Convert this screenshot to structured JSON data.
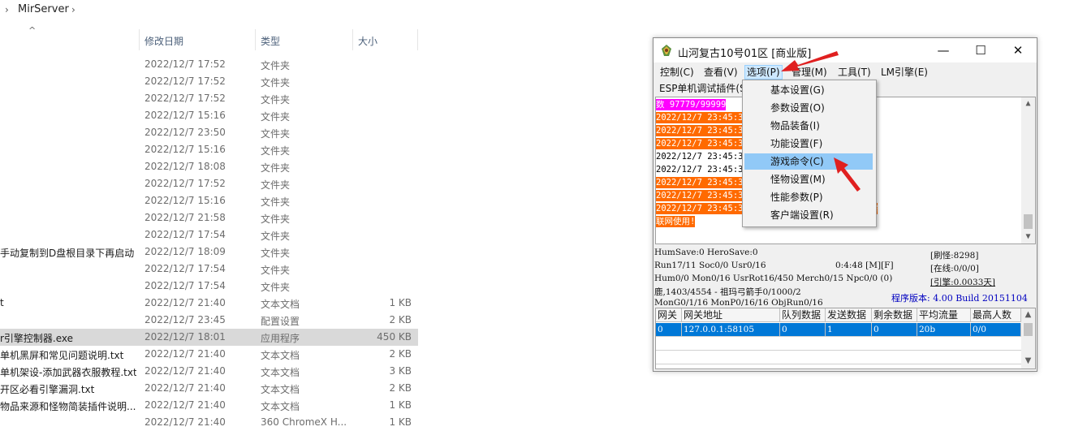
{
  "explorer": {
    "breadcrumb": {
      "chevron_left": "›",
      "folder": "MirServer",
      "chevron_right": "›"
    },
    "sort_indicator": "^",
    "columns": {
      "date": "修改日期",
      "type": "类型",
      "size": "大小"
    },
    "rows": [
      {
        "name": "",
        "date": "2022/12/7 17:52",
        "type": "文件夹",
        "size": ""
      },
      {
        "name": "",
        "date": "2022/12/7 17:52",
        "type": "文件夹",
        "size": ""
      },
      {
        "name": "",
        "date": "2022/12/7 17:52",
        "type": "文件夹",
        "size": ""
      },
      {
        "name": "",
        "date": "2022/12/7 15:16",
        "type": "文件夹",
        "size": ""
      },
      {
        "name": "",
        "date": "2022/12/7 23:50",
        "type": "文件夹",
        "size": ""
      },
      {
        "name": "",
        "date": "2022/12/7 15:16",
        "type": "文件夹",
        "size": ""
      },
      {
        "name": "",
        "date": "2022/12/7 18:08",
        "type": "文件夹",
        "size": ""
      },
      {
        "name": "",
        "date": "2022/12/7 17:52",
        "type": "文件夹",
        "size": ""
      },
      {
        "name": "",
        "date": "2022/12/7 15:16",
        "type": "文件夹",
        "size": ""
      },
      {
        "name": "",
        "date": "2022/12/7 21:58",
        "type": "文件夹",
        "size": ""
      },
      {
        "name": "",
        "date": "2022/12/7 17:54",
        "type": "文件夹",
        "size": ""
      },
      {
        "name": "手动复制到D盘根目录下再启动",
        "date": "2022/12/7 18:09",
        "type": "文件夹",
        "size": ""
      },
      {
        "name": "",
        "date": "2022/12/7 17:54",
        "type": "文件夹",
        "size": ""
      },
      {
        "name": "",
        "date": "2022/12/7 17:54",
        "type": "文件夹",
        "size": ""
      },
      {
        "name": "t",
        "date": "2022/12/7 21:40",
        "type": "文本文档",
        "size": "1 KB"
      },
      {
        "name": "",
        "date": "2022/12/7 23:45",
        "type": "配置设置",
        "size": "2 KB"
      },
      {
        "name": "r引擎控制器.exe",
        "date": "2022/12/7 18:01",
        "type": "应用程序",
        "size": "450 KB",
        "selected": true
      },
      {
        "name": "单机黑屏和常见问题说明.txt",
        "date": "2022/12/7 21:40",
        "type": "文本文档",
        "size": "2 KB"
      },
      {
        "name": "单机架设-添加武器衣服教程.txt",
        "date": "2022/12/7 21:40",
        "type": "文本文档",
        "size": "3 KB"
      },
      {
        "name": "开区必看引擎漏洞.txt",
        "date": "2022/12/7 21:40",
        "type": "文本文档",
        "size": "2 KB"
      },
      {
        "name": "物品来源和怪物简装插件说明....",
        "date": "2022/12/7 21:40",
        "type": "文本文档",
        "size": "1 KB"
      },
      {
        "name": "",
        "date": "2022/12/7 21:40",
        "type": "360 ChromeX H...",
        "size": "1 KB"
      }
    ]
  },
  "app": {
    "title": "山河复古10号01区 [商业版]",
    "controls": {
      "minimize": "—",
      "maximize": "☐",
      "close": "✕"
    },
    "menu": [
      "控制(C)",
      "查看(V)",
      "选项(P)",
      "管理(M)",
      "工具(T)",
      "LM引擎(E)"
    ],
    "menu_row2": "ESP单机调试插件(S",
    "log": [
      {
        "text": "数 97779/99999",
        "style": "magenta"
      },
      {
        "text": "2022/12/7 23:45:30",
        "style": "orange"
      },
      {
        "text": "2022/12/7 23:45:30                              部间修复成功...",
        "style": "orange"
      },
      {
        "text": "2022/12/7 23:45:30",
        "style": "orange"
      },
      {
        "text": "2022/12/7 23:45:31                              0)连接成功...",
        "style": "plain"
      },
      {
        "text": "2022/12/7 23:45:32                              5)已打开...",
        "style": "plain"
      },
      {
        "text": "2022/12/7 23:45:33                              门修复成功...",
        "style": "orange"
      },
      {
        "text": "2022/12/7 23:45:33                              0)",
        "style": "orange"
      },
      {
        "text": "2022/12/7 23:45:33                              行止用途，上限5人，不反挂，需",
        "style": "orange"
      },
      {
        "text": "联网使用!",
        "style": "orange"
      }
    ],
    "status": {
      "l1": "HumSave:0 HeroSave:0",
      "l2": "Run17/11 Soc0/0 Usr0/16",
      "l2b": "0:4:48 [M][F]",
      "l3": "Hum0/0 Mon0/16 UsrRot16/450 Merch0/15 Npc0/0 (0)",
      "l4": "鹿,1403/4554 - 祖玛弓箭手0/1000/2",
      "l5": "MonG0/1/16 MonP0/16/16 ObjRun0/16",
      "r1": "[刷怪:8298]",
      "r2": "[在线:0/0/0]",
      "r3": "[引擎:0.0033天]",
      "version": "程序版本: 4.00 Build 20151104"
    },
    "grid": {
      "headers": [
        "网关",
        "网关地址",
        "队列数据",
        "发送数据",
        "剩余数据",
        "平均流量",
        "最高人数"
      ],
      "rows": [
        [
          "0",
          "127.0.0.1:58105",
          "0",
          "1",
          "0",
          "20b",
          "0/0"
        ]
      ]
    }
  },
  "dropdown": {
    "items": [
      "基本设置(G)",
      "参数设置(O)",
      "物品装备(I)",
      "功能设置(F)",
      "游戏命令(C)",
      "怪物设置(M)",
      "性能参数(P)",
      "客户端设置(R)"
    ],
    "highlighted": "游戏命令(C)"
  },
  "colors": {
    "log_orange": "#ff6a00",
    "log_magenta": "#ff00ff",
    "selection_blue": "#0078d7",
    "menu_hover": "#91c9f7",
    "arrow_red": "#e02020"
  },
  "icons": [
    "chevron-right-icon",
    "sort-up-icon",
    "app-logo-icon",
    "minimize-icon",
    "maximize-icon",
    "close-icon",
    "scroll-up-icon",
    "scroll-down-icon",
    "red-arrow-annotation"
  ]
}
